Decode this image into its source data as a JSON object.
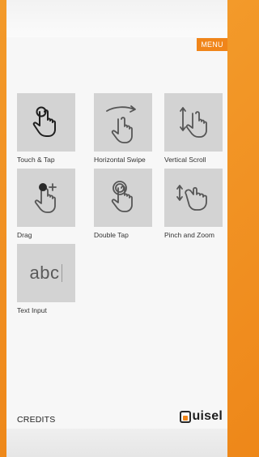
{
  "header": {
    "menu_label": "MENU"
  },
  "tiles": [
    {
      "label": "Touch & Tap",
      "icon": "touch-tap-icon"
    },
    {
      "label": "Horizontal Swipe",
      "icon": "horizontal-swipe-icon"
    },
    {
      "label": "Vertical Scroll",
      "icon": "vertical-scroll-icon"
    },
    {
      "label": "Drag",
      "icon": "drag-icon"
    },
    {
      "label": "Double Tap",
      "icon": "double-tap-icon"
    },
    {
      "label": "Pinch and Zoom",
      "icon": "pinch-zoom-icon"
    },
    {
      "label": "Text Input",
      "icon": "text-input-icon",
      "preview_text": "abc"
    }
  ],
  "footer": {
    "credits_label": "CREDITS",
    "logo_text": "uisel"
  },
  "colors": {
    "accent": "#f0851a",
    "tile_bg": "#d3d3d3",
    "panel_bg": "#f7f7f7"
  }
}
